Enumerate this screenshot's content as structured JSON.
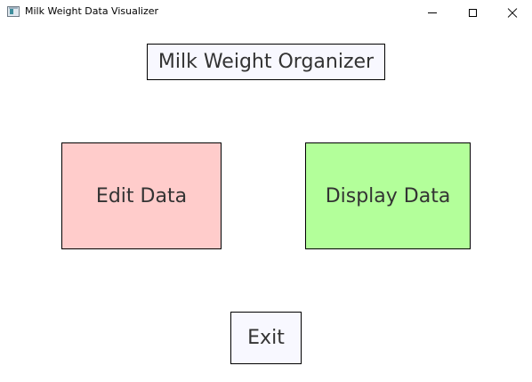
{
  "window": {
    "title": "Milk Weight Data Visualizer",
    "icon": "app-window-icon",
    "controls": [
      "minimize-icon",
      "maximize-icon",
      "close-icon"
    ]
  },
  "main": {
    "heading": "Milk Weight Organizer",
    "buttons": {
      "edit_label": "Edit Data",
      "display_label": "Display Data",
      "exit_label": "Exit"
    }
  },
  "colors": {
    "edit_bg": "#ffcccb",
    "display_bg": "#b3ff9a",
    "neutral_bg": "#f8f8ff",
    "text": "#333333"
  }
}
